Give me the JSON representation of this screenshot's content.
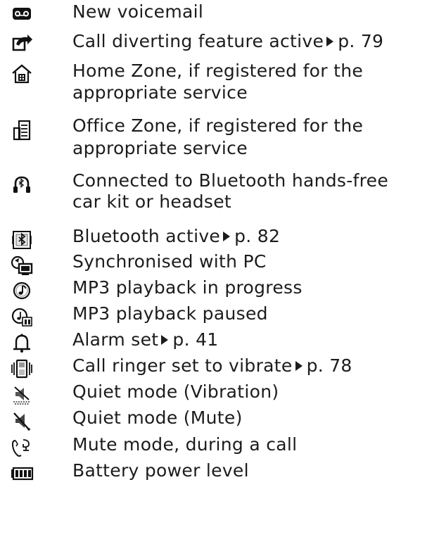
{
  "items": [
    {
      "icon": "voicemail-icon",
      "lines": [
        "New voicemail"
      ]
    },
    {
      "icon": "call-divert-icon",
      "lines": [
        "Call diverting feature active"
      ],
      "ref": "p. 79"
    },
    {
      "icon": "home-zone-icon",
      "lines": [
        "Home Zone, if registered for the",
        "appropriate service"
      ]
    },
    {
      "icon": "office-zone-icon",
      "lines": [
        "Office Zone, if registered for the",
        "appropriate service"
      ]
    },
    {
      "icon": "bluetooth-headset-icon",
      "lines": [
        "Connected to Bluetooth hands-free",
        "car kit or headset"
      ]
    },
    {
      "icon": "bluetooth-active-icon",
      "lines": [
        "Bluetooth active"
      ],
      "ref": "p. 82"
    },
    {
      "icon": "pc-sync-icon",
      "lines": [
        "Synchronised with PC"
      ]
    },
    {
      "icon": "mp3-play-icon",
      "lines": [
        "MP3 playback in progress"
      ]
    },
    {
      "icon": "mp3-paused-icon",
      "lines": [
        "MP3 playback paused"
      ]
    },
    {
      "icon": "alarm-bell-icon",
      "lines": [
        "Alarm set"
      ],
      "ref": "p. 41"
    },
    {
      "icon": "vibrate-icon",
      "lines": [
        "Call ringer set to vibrate"
      ],
      "ref": "p. 78"
    },
    {
      "icon": "quiet-vibration-icon",
      "lines": [
        "Quiet mode (Vibration)"
      ]
    },
    {
      "icon": "quiet-mute-icon",
      "lines": [
        "Quiet mode (Mute)"
      ]
    },
    {
      "icon": "mute-call-icon",
      "lines": [
        "Mute mode, during a call"
      ]
    },
    {
      "icon": "battery-icon",
      "lines": [
        "Battery power level"
      ]
    }
  ]
}
